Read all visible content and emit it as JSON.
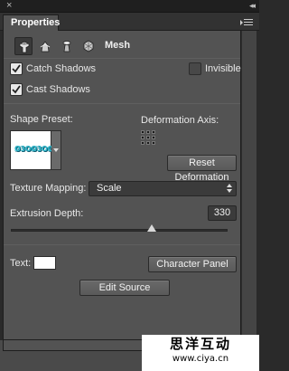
{
  "window": {
    "close_glyph": "×",
    "collapse_glyph": "◂◂"
  },
  "panel": {
    "title": "Properties",
    "menu_icon": "panel-menu-icon"
  },
  "mode_bar": {
    "icons": [
      "mesh-mode-icon",
      "deform-mode-icon",
      "cap-mode-icon",
      "coordinates-mode-icon"
    ],
    "active_index": 0,
    "label": "Mesh"
  },
  "options": {
    "catch_shadows": {
      "label": "Catch Shadows",
      "checked": true
    },
    "invisible": {
      "label": "Invisible",
      "checked": false
    },
    "cast_shadows": {
      "label": "Cast Shadows",
      "checked": true
    }
  },
  "shape_preset": {
    "label": "Shape Preset:",
    "preview_text": "Ø3OØ3OØ"
  },
  "deformation_axis": {
    "label": "Deformation Axis:",
    "reset_button": "Reset Deformation"
  },
  "texture_mapping": {
    "label": "Texture Mapping:",
    "value": "Scale"
  },
  "extrusion_depth": {
    "label": "Extrusion Depth:",
    "value": "330",
    "slider_fraction": 0.65
  },
  "text_row": {
    "label": "Text:",
    "swatch_color": "#ffffff",
    "character_panel_button": "Character Panel",
    "edit_source_button": "Edit Source"
  },
  "watermark": {
    "title": "思洋互动",
    "url": "www.ciya.cn"
  }
}
